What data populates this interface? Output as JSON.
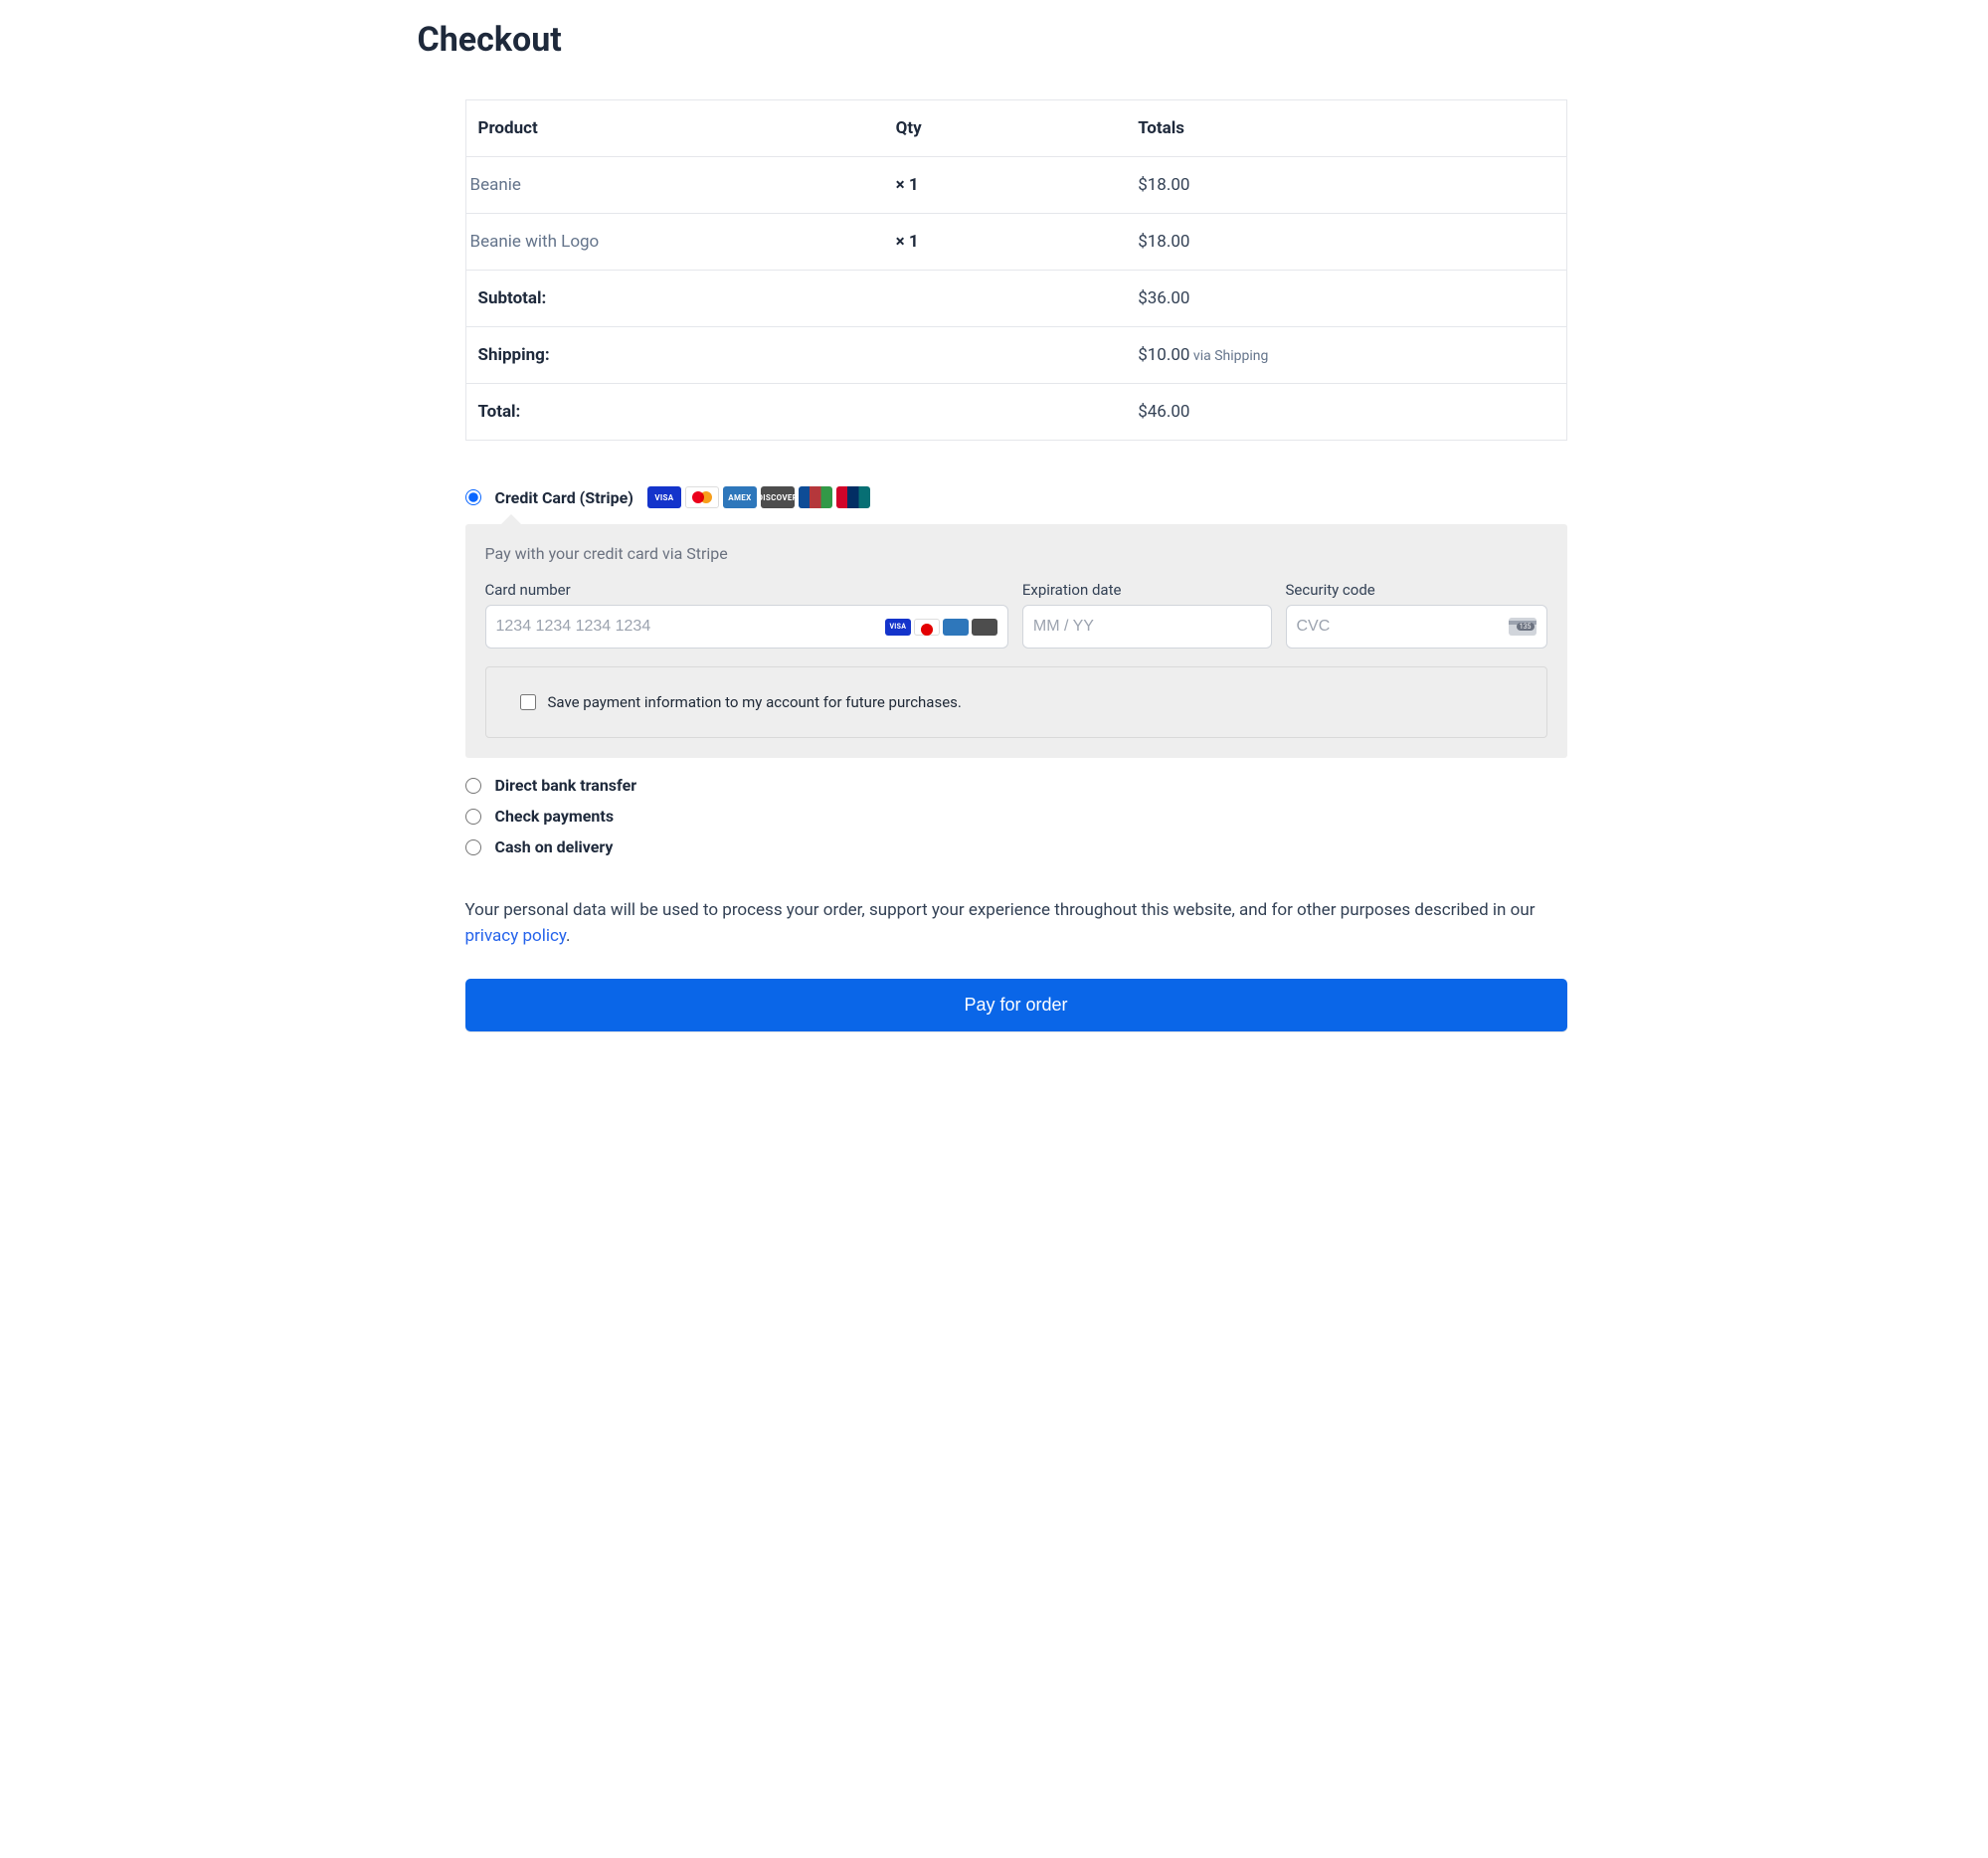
{
  "page_title": "Checkout",
  "table": {
    "headers": {
      "product": "Product",
      "qty": "Qty",
      "totals": "Totals"
    },
    "items": [
      {
        "name": "Beanie",
        "qty": "× 1",
        "total": "$18.00"
      },
      {
        "name": "Beanie with Logo",
        "qty": "× 1",
        "total": "$18.00"
      }
    ],
    "subtotal_label": "Subtotal:",
    "subtotal_value": "$36.00",
    "shipping_label": "Shipping:",
    "shipping_value": "$10.00",
    "shipping_via": " via Shipping",
    "total_label": "Total:",
    "total_value": "$46.00"
  },
  "payment": {
    "stripe_label": "Credit Card (Stripe)",
    "stripe_desc": "Pay with your credit card via Stripe",
    "card_number_label": "Card number",
    "card_number_placeholder": "1234 1234 1234 1234",
    "exp_label": "Expiration date",
    "exp_placeholder": "MM / YY",
    "cvc_label": "Security code",
    "cvc_placeholder": "CVC",
    "cvc_pill": "135",
    "save_label": "Save payment information to my account for future purchases.",
    "bank_label": "Direct bank transfer",
    "check_label": "Check payments",
    "cod_label": "Cash on delivery",
    "card_brands": {
      "visa": "VISA",
      "amex": "AMEX",
      "discover": "DISCOVER",
      "jcb": "JCB",
      "unionpay": "UnionPay"
    }
  },
  "privacy": {
    "text": "Your personal data will be used to process your order, support your experience throughout this website, and for other purposes described in our ",
    "link": "privacy policy",
    "suffix": "."
  },
  "pay_button": "Pay for order"
}
